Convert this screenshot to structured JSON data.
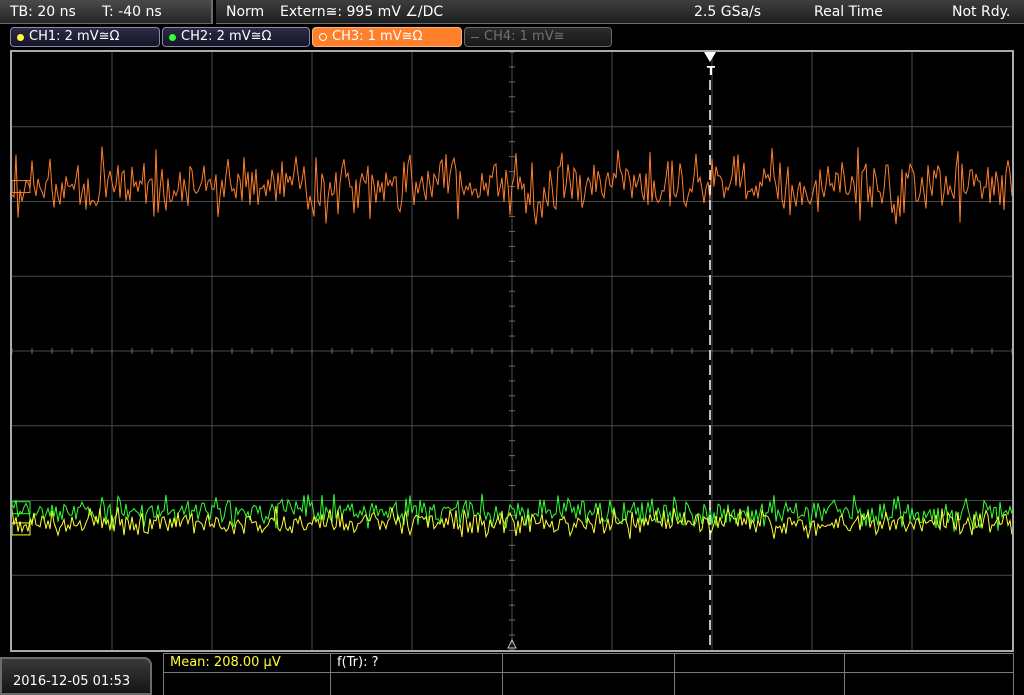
{
  "status_bar": {
    "timebase": "TB: 20 ns",
    "trigger_time": "T: -40 ns",
    "acq_mode": "Norm",
    "trigger_source": "Extern≅: 995 mV ∠/DC",
    "sample_rate": "2.5 GSa/s",
    "acq_type": "Real Time",
    "trigger_state": "Not Rdy."
  },
  "channels": [
    {
      "id": "ch1",
      "label": "CH1: 2 mV≅Ω",
      "color": "#ffff33",
      "state": "on"
    },
    {
      "id": "ch2",
      "label": "CH2: 2 mV≅Ω",
      "color": "#33ff33",
      "state": "on"
    },
    {
      "id": "ch3",
      "label": "CH3: 1 mV≅Ω",
      "color": "#ff7f2a",
      "state": "active"
    },
    {
      "id": "ch4",
      "label": "CH4: 1 mV≅",
      "color": "#707070",
      "state": "off"
    }
  ],
  "trigger_marker": {
    "label": "T"
  },
  "measurements": {
    "mean": "Mean: 208.00 µV",
    "freq": "f(Tr): ?"
  },
  "datetime": "2016-12-05 01:53",
  "colors": {
    "ch1": "#ffff33",
    "ch2": "#33ff33",
    "ch3": "#ff7f2a",
    "grid": "#4a4a4a",
    "frame": "#aaaaaa"
  },
  "waveforms": {
    "ch3": {
      "offset_div": 1.8,
      "noise_div": 0.3,
      "seed": 7
    },
    "ch2": {
      "offset_div": 6.15,
      "noise_div": 0.15,
      "seed": 19
    },
    "ch1": {
      "offset_div": 6.3,
      "noise_div": 0.12,
      "seed": 31
    }
  }
}
